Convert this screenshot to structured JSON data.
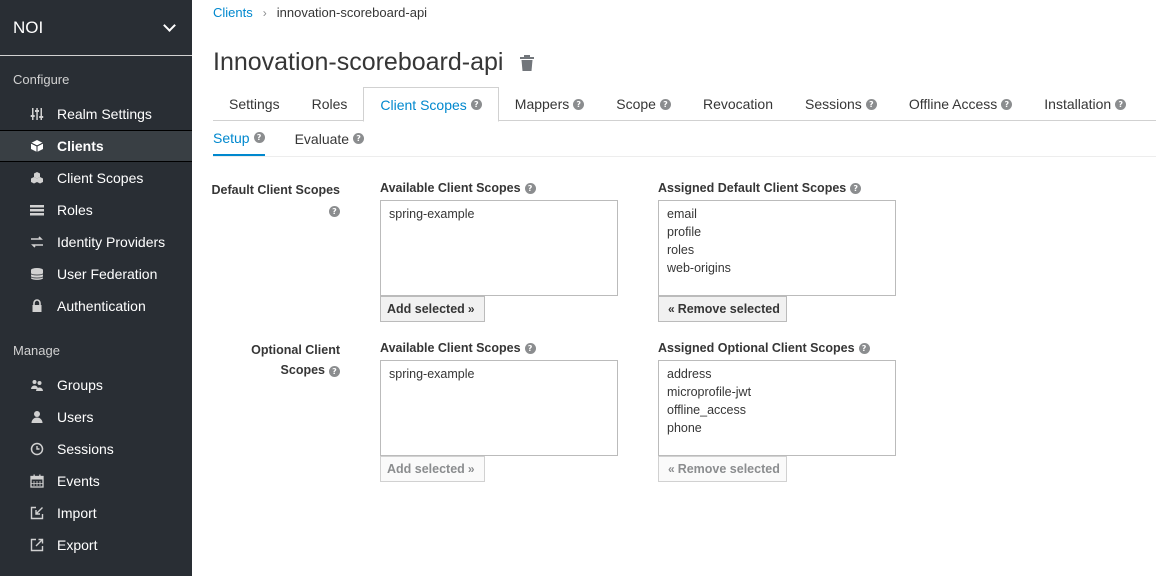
{
  "sidebar": {
    "realm": "NOI",
    "configure_heading": "Configure",
    "manage_heading": "Manage",
    "configure_items": [
      {
        "label": "Realm Settings",
        "icon": "sliders-icon"
      },
      {
        "label": "Clients",
        "icon": "cube-icon",
        "active": true
      },
      {
        "label": "Client Scopes",
        "icon": "cubes-icon"
      },
      {
        "label": "Roles",
        "icon": "list-icon"
      },
      {
        "label": "Identity Providers",
        "icon": "exchange-icon"
      },
      {
        "label": "User Federation",
        "icon": "database-icon"
      },
      {
        "label": "Authentication",
        "icon": "lock-icon"
      }
    ],
    "manage_items": [
      {
        "label": "Groups",
        "icon": "users-icon"
      },
      {
        "label": "Users",
        "icon": "user-icon"
      },
      {
        "label": "Sessions",
        "icon": "clock-icon"
      },
      {
        "label": "Events",
        "icon": "calendar-icon"
      },
      {
        "label": "Import",
        "icon": "import-icon"
      },
      {
        "label": "Export",
        "icon": "export-icon"
      }
    ]
  },
  "breadcrumb": {
    "parent": "Clients",
    "current": "innovation-scoreboard-api"
  },
  "page_title": "Innovation-scoreboard-api",
  "tabs": [
    {
      "label": "Settings",
      "help": false
    },
    {
      "label": "Roles",
      "help": false
    },
    {
      "label": "Client Scopes",
      "help": true,
      "active": true
    },
    {
      "label": "Mappers",
      "help": true
    },
    {
      "label": "Scope",
      "help": true
    },
    {
      "label": "Revocation",
      "help": false
    },
    {
      "label": "Sessions",
      "help": true
    },
    {
      "label": "Offline Access",
      "help": true
    },
    {
      "label": "Installation",
      "help": true
    }
  ],
  "subtabs": [
    {
      "label": "Setup",
      "active": true
    },
    {
      "label": "Evaluate"
    }
  ],
  "default_scopes": {
    "label": "Default Client Scopes",
    "available_heading": "Available Client Scopes",
    "available": [
      "spring-example"
    ],
    "assigned_heading": "Assigned Default Client Scopes",
    "assigned": [
      "email",
      "profile",
      "roles",
      "web-origins"
    ],
    "add_button": "Add selected",
    "remove_button": "Remove selected"
  },
  "optional_scopes": {
    "label_line1": "Optional Client",
    "label_line2": "Scopes",
    "available_heading": "Available Client Scopes",
    "available": [
      "spring-example"
    ],
    "assigned_heading": "Assigned Optional Client Scopes",
    "assigned": [
      "address",
      "microprofile-jwt",
      "offline_access",
      "phone"
    ],
    "add_button": "Add selected",
    "remove_button": "Remove selected"
  },
  "colors": {
    "sidebar_bg": "#292e34",
    "link": "#0088ce"
  }
}
